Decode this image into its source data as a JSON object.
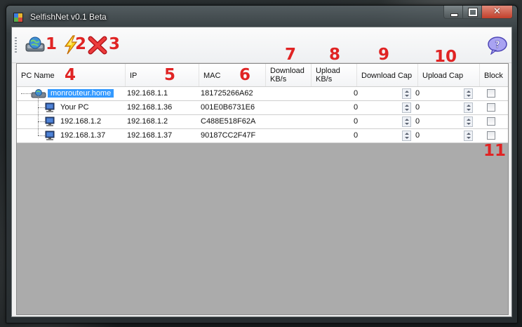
{
  "window": {
    "title": "SelfishNet v0.1 Beta"
  },
  "toolbar": {
    "buttons": [
      {
        "icon": "network-globe-icon",
        "number": "1"
      },
      {
        "icon": "lightning-icon",
        "number": "2"
      },
      {
        "icon": "red-x-icon",
        "number": "3"
      },
      {
        "icon": "help-question-icon"
      }
    ]
  },
  "columns": [
    {
      "label": "PC Name",
      "number": "4"
    },
    {
      "label": "IP",
      "number": "5"
    },
    {
      "label": "MAC",
      "number": "6"
    },
    {
      "label": "Download\nKB/s",
      "number": "7"
    },
    {
      "label": "Upload\nKB/s",
      "number": "8"
    },
    {
      "label": "Download Cap",
      "number": "9"
    },
    {
      "label": "Upload Cap",
      "number": "10"
    },
    {
      "label": "Block"
    }
  ],
  "rows": [
    {
      "name": "monrouteur.home",
      "ip": "192.168.1.1",
      "mac": "181725266A62",
      "download_cap": "0",
      "upload_cap": "0",
      "selected": true
    },
    {
      "name": "Your PC",
      "ip": "192.168.1.36",
      "mac": "001E0B6731E6",
      "download_cap": "0",
      "upload_cap": "0"
    },
    {
      "name": "192.168.1.2",
      "ip": "192.168.1.2",
      "mac": "C488E518F62A",
      "download_cap": "0",
      "upload_cap": "0"
    },
    {
      "name": "192.168.1.37",
      "ip": "192.168.1.37",
      "mac": "90187CC2F47F",
      "download_cap": "0",
      "upload_cap": "0"
    }
  ],
  "annotation_block_number": "11",
  "colors": {
    "annotation": "#e02424",
    "selection": "#3399ff"
  }
}
